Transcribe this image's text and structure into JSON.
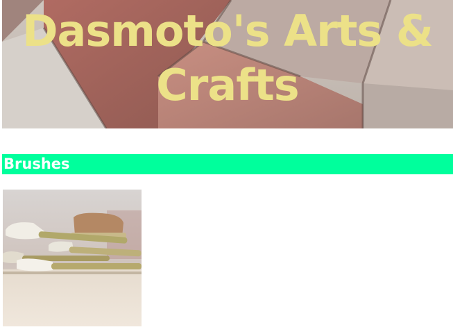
{
  "header": {
    "title": "Dasmoto's Arts & Crafts",
    "title_color": "#ece188",
    "background": "brick-tile-photo"
  },
  "sections": [
    {
      "title": "Brushes",
      "bar_color": "#00ff9c",
      "image": "paint-brushes-photo"
    }
  ]
}
